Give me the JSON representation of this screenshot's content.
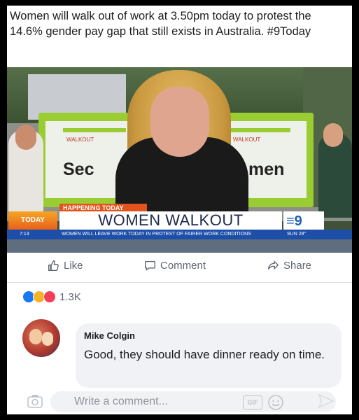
{
  "post": {
    "text": "Women will walk out of work at 3.50pm today to protest the 14.6% gender pay gap that still exists in Australia. #9Today"
  },
  "video": {
    "banner_left": "Sec",
    "banner_right": "men",
    "banner_logo": "WALKOUT",
    "happening": "HAPPENING TODAY",
    "headline": "WOMEN WALKOUT",
    "today_logo": "TODAY",
    "ticker_time": "7:13",
    "ticker_text": "WOMEN WILL LEAVE WORK TODAY IN PROTEST OF FAIRER WORK CONDITIONS",
    "ticker_day": "SUN 28°"
  },
  "actions": {
    "like": "Like",
    "comment": "Comment",
    "share": "Share"
  },
  "reactions": {
    "count": "1.3K"
  },
  "comment": {
    "author": "Mike Colgin",
    "text": "Good, they should have dinner ready on time."
  },
  "composer": {
    "placeholder": "Write a comment...",
    "gif_label": "GIF"
  },
  "colors": {
    "like_blue": "#1877f2",
    "ticker_blue": "#1d4fa8",
    "banner_green": "#9acd32",
    "happening_orange": "#e2541b"
  }
}
